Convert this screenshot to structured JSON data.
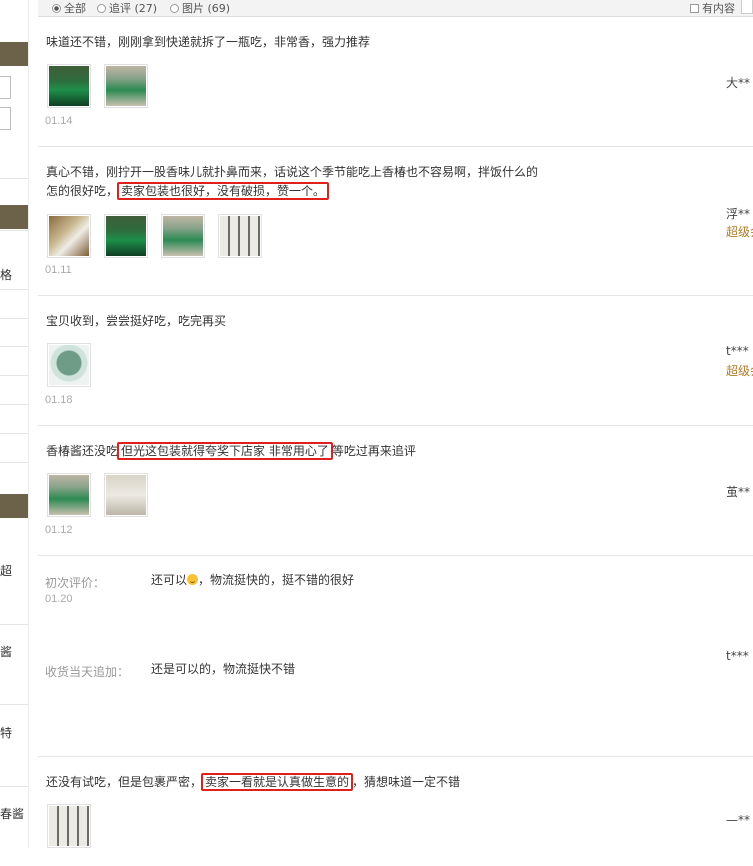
{
  "filter": {
    "all": "全部",
    "append": "追评 (27)",
    "pics": "图片 (69)",
    "has_content": "有内容"
  },
  "sidebar": {
    "text1": "格",
    "text2": "超",
    "text3": "酱",
    "text4": "特",
    "text5": "春酱"
  },
  "reviews": [
    {
      "text": "味道还不错，刚刚拿到快递就拆了一瓶吃，非常香，强力推荐",
      "date": "01.14",
      "user": "大**"
    },
    {
      "text_line1": "真心不错，刚拧开一股香味儿就扑鼻而来，话说这个季节能吃上香椿也不容易啊，拌饭什么的",
      "text_line2_pre": "怎的很好吃，",
      "text_line2_hl": "卖家包装也很好，没有破损，赞一个。",
      "date": "01.11",
      "user": "浮**",
      "level": "超级会员"
    },
    {
      "text": "宝贝收到，尝尝挺好吃，吃完再买",
      "date": "01.18",
      "user": "t***",
      "level": "超级会员"
    },
    {
      "text_pre": "香椿酱还没吃",
      "text_hl": "但光这包装就得夸奖下店家 非常用心了",
      "text_post": "等吃过再来追评",
      "date": "01.12",
      "user": "茧**"
    },
    {
      "initial_label": "初次评价：",
      "initial_text_pre": "还可以",
      "initial_text_post": "，物流挺快的，挺不错的很好",
      "date": "01.20",
      "append_label": "收货当天追加：",
      "append_text": "还是可以的，物流挺快不错",
      "user": "t***"
    },
    {
      "text_pre": "还没有试吃，但是包裹严密，",
      "text_hl": "卖家一看就是认真做生意的",
      "text_post": "，猜想味道一定不错",
      "user": "—**"
    }
  ]
}
